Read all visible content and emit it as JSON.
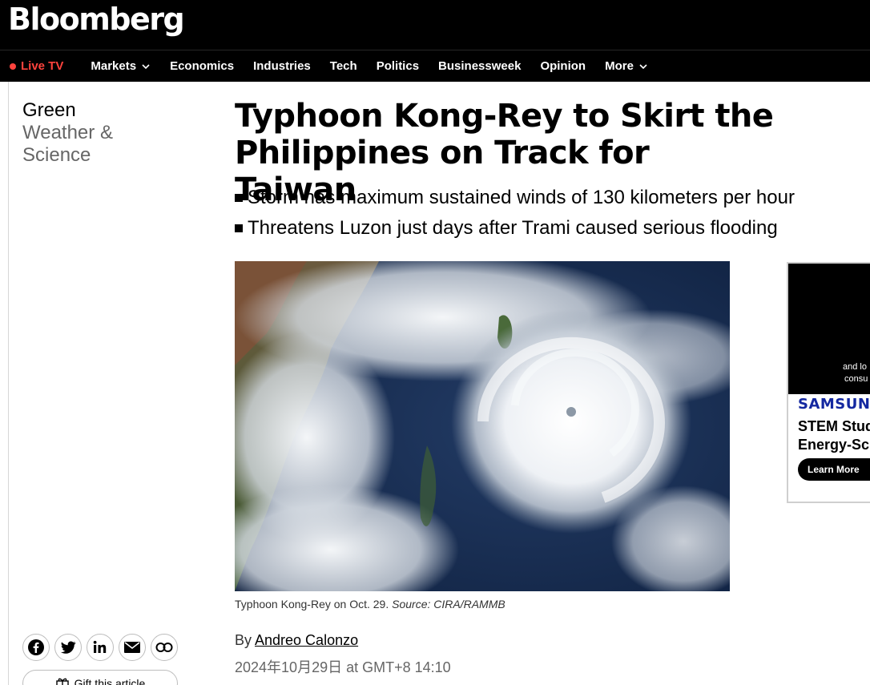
{
  "brand": {
    "logo": "Bloomberg"
  },
  "nav": {
    "live_tv": "Live TV",
    "items": [
      "Markets",
      "Economics",
      "Industries",
      "Tech",
      "Politics",
      "Businessweek",
      "Opinion",
      "More"
    ]
  },
  "section": {
    "primary": "Green",
    "secondary_line1": "Weather &",
    "secondary_line2": "Science"
  },
  "article": {
    "headline_line1": "Typhoon Kong-Rey to Skirt the",
    "headline_line2": "Philippines on Track for Taiwan",
    "bullets": [
      "Storm has maximum sustained winds of 130 kilometers per hour",
      "Threatens Luzon just days after Trami caused serious flooding"
    ],
    "image_alt": "Satellite view of Typhoon Kong-Rey",
    "caption_text": "Typhoon Kong-Rey on Oct. 29. ",
    "caption_source": "Source: CIRA/RAMMB",
    "byline_prefix": "By ",
    "author": "Andreo Calonzo",
    "timestamp": "2024年10月29日 at GMT+8 14:10"
  },
  "share": {
    "icons": [
      "facebook-icon",
      "twitter-icon",
      "linkedin-icon",
      "email-icon",
      "link-icon"
    ],
    "gift_label": "Gift this article"
  },
  "ad": {
    "tag_line1": "and lo",
    "tag_line2": "consu",
    "brand": "SAMSUNG",
    "copy_line1": "STEM Stud",
    "copy_line2": "Energy-Sc",
    "cta": "Learn More"
  },
  "colors": {
    "live_red": "#ff433d",
    "header_bg": "#000000",
    "samsung_blue": "#1428a0"
  }
}
